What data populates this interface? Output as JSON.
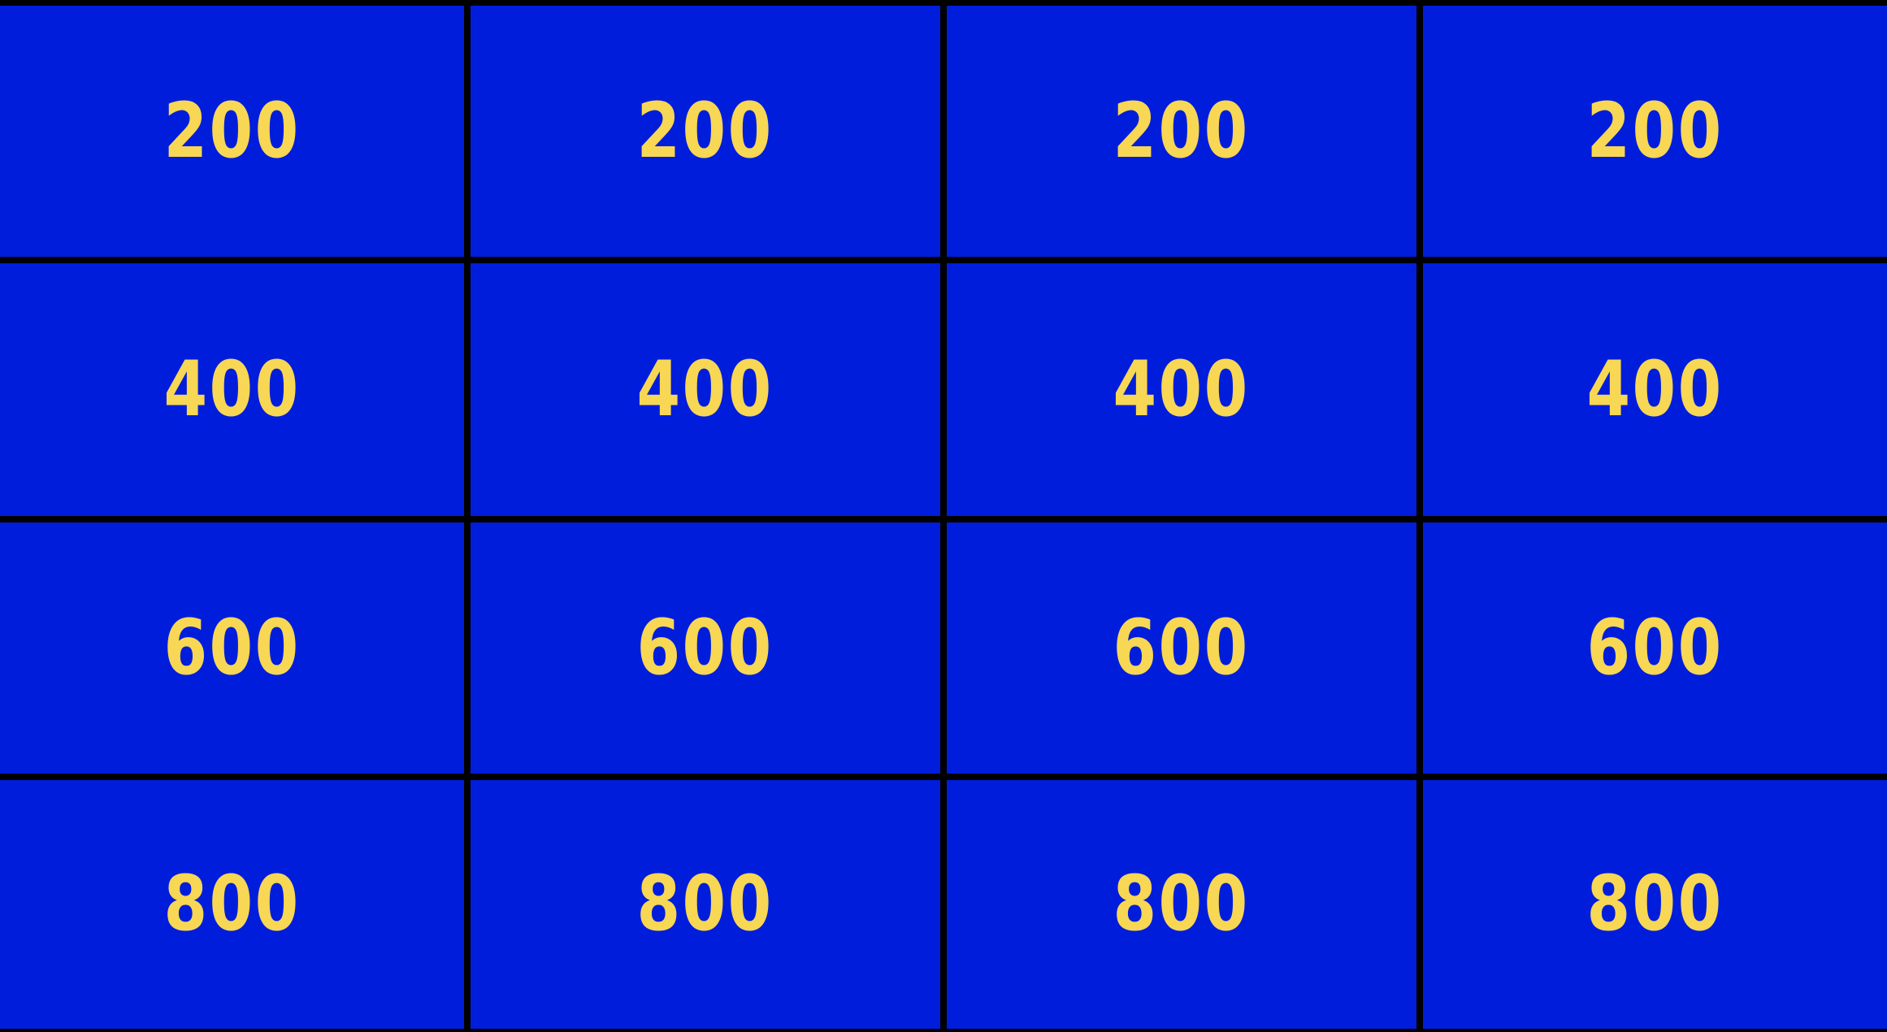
{
  "board": {
    "colors": {
      "cell_background": "#001ddc",
      "value_text": "#f7d753",
      "grid_lines": "#000000"
    },
    "rows": [
      {
        "cells": [
          {
            "value": "200"
          },
          {
            "value": "200"
          },
          {
            "value": "200"
          },
          {
            "value": "200"
          }
        ]
      },
      {
        "cells": [
          {
            "value": "400"
          },
          {
            "value": "400"
          },
          {
            "value": "400"
          },
          {
            "value": "400"
          }
        ]
      },
      {
        "cells": [
          {
            "value": "600"
          },
          {
            "value": "600"
          },
          {
            "value": "600"
          },
          {
            "value": "600"
          }
        ]
      },
      {
        "cells": [
          {
            "value": "800"
          },
          {
            "value": "800"
          },
          {
            "value": "800"
          },
          {
            "value": "800"
          }
        ]
      }
    ]
  }
}
